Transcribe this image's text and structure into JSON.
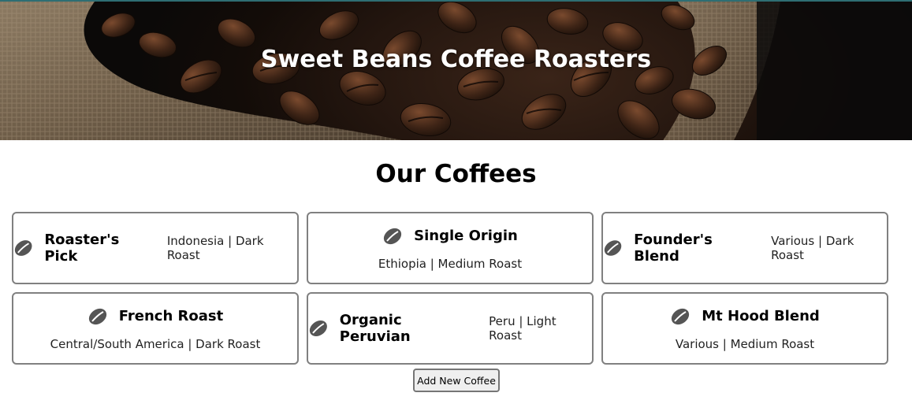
{
  "header": {
    "title": "Sweet Beans Coffee Roasters",
    "banner_image": "coffee-beans-burlap-sack"
  },
  "main": {
    "section_title": "Our Coffees",
    "coffees": [
      {
        "name": "Roaster's Pick",
        "description": "Indonesia | Dark Roast",
        "icon": "coffee-bean-icon"
      },
      {
        "name": "Single Origin",
        "description": "Ethiopia | Medium Roast",
        "icon": "coffee-bean-icon"
      },
      {
        "name": "Founder's Blend",
        "description": "Various | Dark Roast",
        "icon": "coffee-bean-icon"
      },
      {
        "name": "French Roast",
        "description": "Central/South America | Dark Roast",
        "icon": "coffee-bean-icon"
      },
      {
        "name": "Organic Peruvian",
        "description": "Peru | Light Roast",
        "icon": "coffee-bean-icon"
      },
      {
        "name": "Mt Hood Blend",
        "description": "Various | Medium Roast",
        "icon": "coffee-bean-icon"
      }
    ],
    "add_button_label": "Add New Coffee"
  },
  "colors": {
    "card_border": "#808080",
    "icon": "#555555",
    "header_accent": "#2e6e73"
  }
}
